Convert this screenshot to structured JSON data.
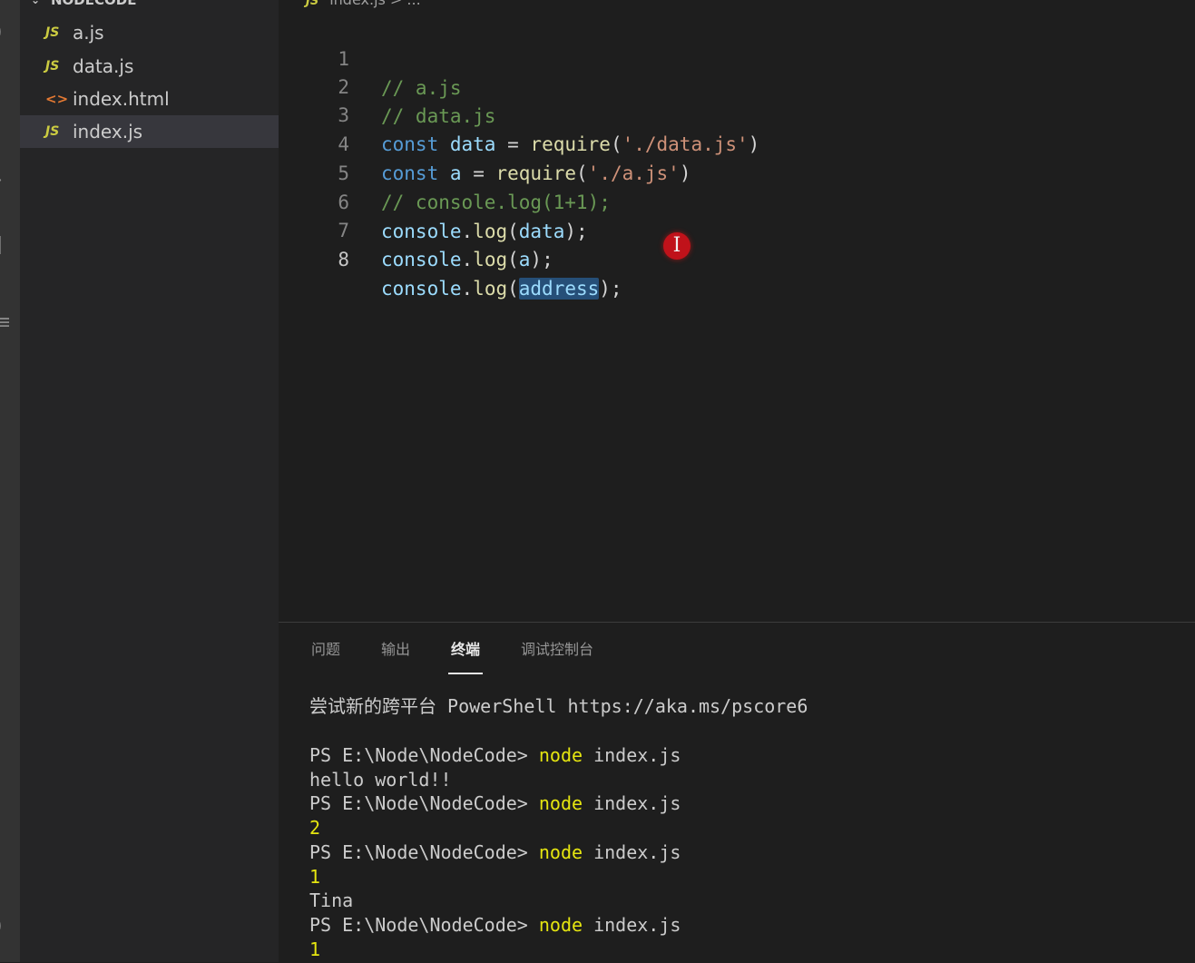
{
  "sidebar": {
    "folder_name": "NODECODE",
    "files": [
      {
        "icon": "JS",
        "name": "a.js"
      },
      {
        "icon": "JS",
        "name": "data.js"
      },
      {
        "icon": "<>",
        "name": "index.html"
      },
      {
        "icon": "JS",
        "name": "index.js"
      }
    ]
  },
  "breadcrumb": {
    "icon": "JS",
    "path": "index.js > ..."
  },
  "editor": {
    "line_numbers": [
      "1",
      "2",
      "3",
      "4",
      "5",
      "6",
      "7",
      "8"
    ],
    "lines": [
      {
        "comment": "// a.js"
      },
      {
        "comment": "// data.js"
      },
      {
        "kw": "const",
        "var": "data",
        "op": "=",
        "fn": "require",
        "open": "(",
        "str": "'./data.js'",
        "close": ")"
      },
      {
        "kw": "const",
        "var": "a",
        "op": "=",
        "fn": "require",
        "open": "(",
        "str": "'./a.js'",
        "close": ")"
      },
      {
        "comment": "// console.log(1+1);"
      },
      {
        "obj": "console",
        "dot": ".",
        "fn": "log",
        "open": "(",
        "arg": "data",
        "close": ");"
      },
      {
        "obj": "console",
        "dot": ".",
        "fn": "log",
        "open": "(",
        "arg": "a",
        "close": ");"
      },
      {
        "obj": "console",
        "dot": ".",
        "fn": "log",
        "open": "(",
        "arg": "address",
        "close": ");"
      }
    ]
  },
  "panel": {
    "tabs": [
      "问题",
      "输出",
      "终端",
      "调试控制台"
    ],
    "active_tab": "终端"
  },
  "terminal": {
    "banner": "尝试新的跨平台 PowerShell https://aka.ms/pscore6",
    "prompt": "PS E:\\Node\\NodeCode> ",
    "command": "node",
    "argument": " index.js",
    "output_hello": "hello world!!",
    "output_2": "2",
    "output_1": "1",
    "output_tina": "Tina",
    "output_1b": "1"
  }
}
